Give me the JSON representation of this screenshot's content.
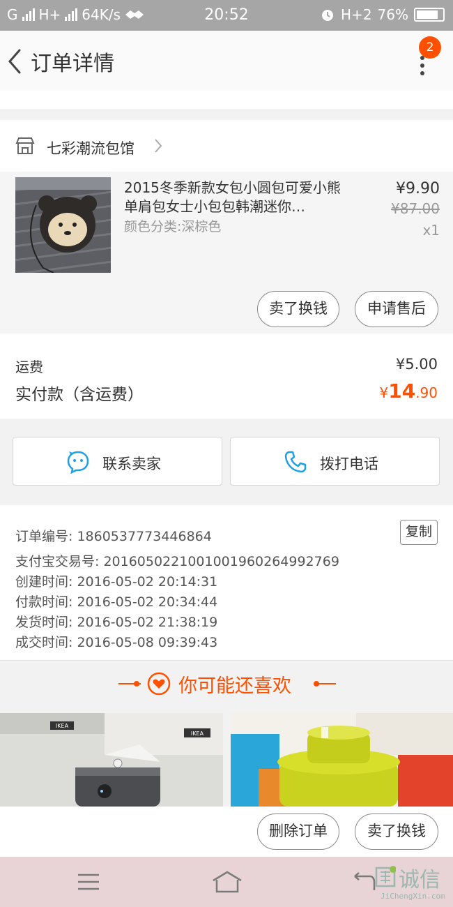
{
  "status_bar": {
    "carrier": "G",
    "network": "H+",
    "speed": "64K/s",
    "time": "20:52",
    "network2": "H+2",
    "battery": "76%"
  },
  "header": {
    "title": "订单详情",
    "badge_count": "2"
  },
  "shop": {
    "name": "七彩潮流包馆"
  },
  "item": {
    "title": "2015冬季新款女包小圆包可爱小熊单肩包女士小包包韩潮迷你…",
    "spec": "颜色分类:深棕色",
    "price": "¥9.90",
    "original_price": "¥87.00",
    "quantity": "x1",
    "actions": [
      "卖了换钱",
      "申请售后"
    ]
  },
  "fees": {
    "shipping_label": "运费",
    "shipping_value": "¥5.00",
    "paid_label": "实付款（含运费）",
    "paid_currency": "¥",
    "paid_int": "14",
    "paid_dec": ".90"
  },
  "contact": {
    "seller_label": "联系卖家",
    "phone_label": "拨打电话"
  },
  "order_info": {
    "order_no": "订单编号: 1860537773446864",
    "copy_label": "复制",
    "alipay_no": "支付宝交易号: 2016050221001001960264992769",
    "created": "创建时间: 2016-05-02 20:14:31",
    "paid": "付款时间: 2016-05-02 20:34:44",
    "shipped": "发货时间: 2016-05-02 21:38:19",
    "completed": "成交时间: 2016-05-08 09:39:43"
  },
  "recommend": {
    "title": "你可能还喜欢",
    "brand_text": "IKEA"
  },
  "bottom_actions": [
    "删除订单",
    "卖了换钱"
  ],
  "watermark": {
    "text": "诚信",
    "sub": "JiChengXin.com"
  },
  "colors": {
    "accent": "#ff5000",
    "status_bar": "#a6a6a6",
    "sys_nav": "#e8d4d6"
  }
}
